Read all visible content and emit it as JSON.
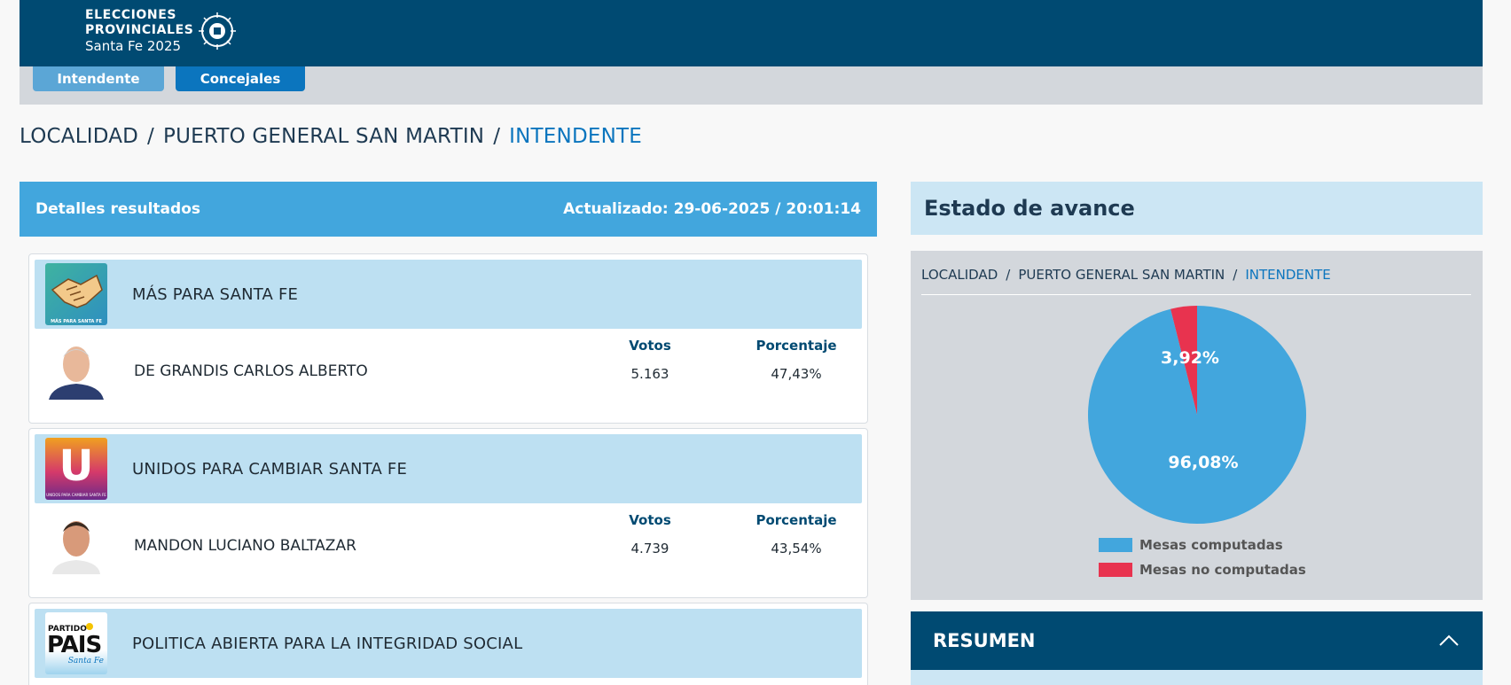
{
  "brand": {
    "line1": "ELECCIONES",
    "line2": "PROVINCIALES",
    "line3": "Santa Fe 2025"
  },
  "tabs": [
    {
      "label": "Intendente"
    },
    {
      "label": "Concejales"
    }
  ],
  "breadcrumb": {
    "items": [
      "LOCALIDAD",
      "PUERTO GENERAL SAN MARTIN",
      "INTENDENTE"
    ],
    "separator": "/"
  },
  "results": {
    "title": "Detalles resultados",
    "updated": "Actualizado: 29-06-2025 / 20:01:14",
    "col_votes": "Votos",
    "col_percent": "Porcentaje",
    "parties": [
      {
        "name": "MÁS PARA SANTA FE",
        "logo_caption": "MÁS PARA SANTA FE",
        "candidate": "DE GRANDIS CARLOS ALBERTO",
        "votes": "5.163",
        "percent": "47,43%"
      },
      {
        "name": "UNIDOS PARA CAMBIAR SANTA FE",
        "logo_caption": "UNIDOS PARA CAMBIAR SANTA FE",
        "logo_letter": "U",
        "candidate": "MANDON LUCIANO BALTAZAR",
        "votes": "4.739",
        "percent": "43,54%"
      },
      {
        "name": "POLITICA ABIERTA PARA LA INTEGRIDAD SOCIAL",
        "logo_word1": "PARTIDO",
        "logo_word2": "PAIS",
        "logo_word3": "Santa Fe"
      }
    ]
  },
  "avance": {
    "title": "Estado de avance",
    "breadcrumb": [
      "LOCALIDAD",
      "PUERTO GENERAL SAN MARTIN",
      "INTENDENTE"
    ],
    "slices": [
      {
        "label": "Mesas computadas",
        "value": 96.08,
        "text": "96,08%",
        "color": "#42a6dd"
      },
      {
        "label": "Mesas no computadas",
        "value": 3.92,
        "text": "3,92%",
        "color": "#e8334f"
      }
    ]
  },
  "resumen": {
    "title": "RESUMEN"
  },
  "colors": {
    "primary": "#004a72",
    "accent": "#0b75be",
    "light": "#bde0f2"
  }
}
